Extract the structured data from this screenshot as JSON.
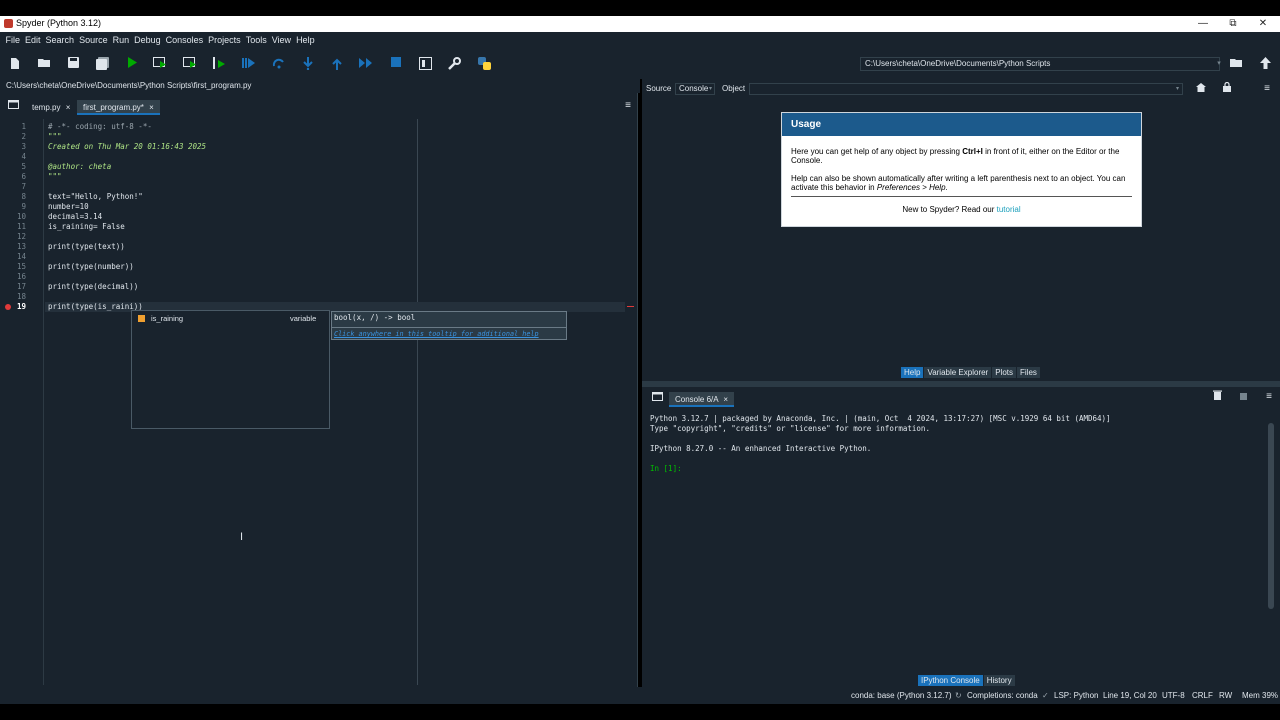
{
  "window": {
    "title": "Spyder (Python 3.12)",
    "minimize": "—",
    "restore": "⧉",
    "close": "✕"
  },
  "menu": [
    "File",
    "Edit",
    "Search",
    "Source",
    "Run",
    "Debug",
    "Consoles",
    "Projects",
    "Tools",
    "View",
    "Help"
  ],
  "toolbar": {
    "working_dir": "C:\\Users\\cheta\\OneDrive\\Documents\\Python Scripts"
  },
  "editor": {
    "path": "C:\\Users\\cheta\\OneDrive\\Documents\\Python Scripts\\first_program.py",
    "tabs": [
      {
        "label": "temp.py",
        "close": "×"
      },
      {
        "label": "first_program.py*",
        "close": "×"
      }
    ],
    "lines": [
      {
        "n": "1",
        "text": "# -*- coding: utf-8 -*-",
        "cls": "c-cmt"
      },
      {
        "n": "2",
        "text": "\"\"\"",
        "cls": "c-str"
      },
      {
        "n": "3",
        "text": "Created on Thu Mar 20 01:16:43 2025",
        "cls": "c-str"
      },
      {
        "n": "4",
        "text": "",
        "cls": "c-str"
      },
      {
        "n": "5",
        "text": "@author: cheta",
        "cls": "c-str"
      },
      {
        "n": "6",
        "text": "\"\"\"",
        "cls": "c-str"
      },
      {
        "n": "7",
        "text": "",
        "cls": "c-def"
      },
      {
        "n": "8",
        "text": "text=\"Hello, Python!\"",
        "cls": "c-def"
      },
      {
        "n": "9",
        "text": "number=10",
        "cls": "c-def"
      },
      {
        "n": "10",
        "text": "decimal=3.14",
        "cls": "c-def"
      },
      {
        "n": "11",
        "text": "is_raining= False",
        "cls": "c-def"
      },
      {
        "n": "12",
        "text": "",
        "cls": "c-def"
      },
      {
        "n": "13",
        "text": "print(type(text))",
        "cls": "c-def"
      },
      {
        "n": "14",
        "text": "",
        "cls": "c-def"
      },
      {
        "n": "15",
        "text": "print(type(number))",
        "cls": "c-def"
      },
      {
        "n": "16",
        "text": "",
        "cls": "c-def"
      },
      {
        "n": "17",
        "text": "print(type(decimal))",
        "cls": "c-def"
      },
      {
        "n": "18",
        "text": "",
        "cls": "c-def"
      },
      {
        "n": "19",
        "text": "print(type(is_raini))",
        "cls": "c-def"
      }
    ],
    "autocomplete": {
      "item": "is_raining",
      "kind": "variable"
    },
    "calltip": {
      "signature": "bool(x, /) -> bool",
      "hint": "Click anywhere in this tooltip for additional help"
    }
  },
  "help": {
    "source_label": "Source",
    "source_value": "Console",
    "object_label": "Object",
    "usage_title": "Usage",
    "p1a": "Here you can get help of any object by pressing ",
    "p1b": "Ctrl+I",
    "p1c": " in front of it, either on the Editor or the Console.",
    "p2a": "Help can also be shown automatically after writing a left parenthesis next to an object. You can activate this behavior in ",
    "p2b": "Preferences > Help",
    "p2c": ".",
    "new_text": "New to Spyder? Read our ",
    "new_link": "tutorial",
    "tabs": [
      "Help",
      "Variable Explorer",
      "Plots",
      "Files"
    ]
  },
  "console": {
    "tab": "Console 6/A",
    "tab_close": "×",
    "lines": [
      "Python 3.12.7 | packaged by Anaconda, Inc. | (main, Oct  4 2024, 13:17:27) [MSC v.1929 64 bit (AMD64)]",
      "Type \"copyright\", \"credits\" or \"license\" for more information.",
      "",
      "IPython 8.27.0 -- An enhanced Interactive Python.",
      "",
      "In [1]:"
    ],
    "tabs": [
      "IPython Console",
      "History"
    ]
  },
  "status": {
    "env": "conda: base (Python 3.12.7)",
    "completions": "Completions: conda",
    "lsp": "LSP: Python",
    "pos": "Line 19, Col 20",
    "enc": "UTF-8",
    "eol": "CRLF",
    "rw": "RW",
    "mem": "Mem 39%"
  },
  "colors": {
    "bg": "#19232d",
    "accent": "#1a72bb",
    "run": "#00aa00"
  }
}
